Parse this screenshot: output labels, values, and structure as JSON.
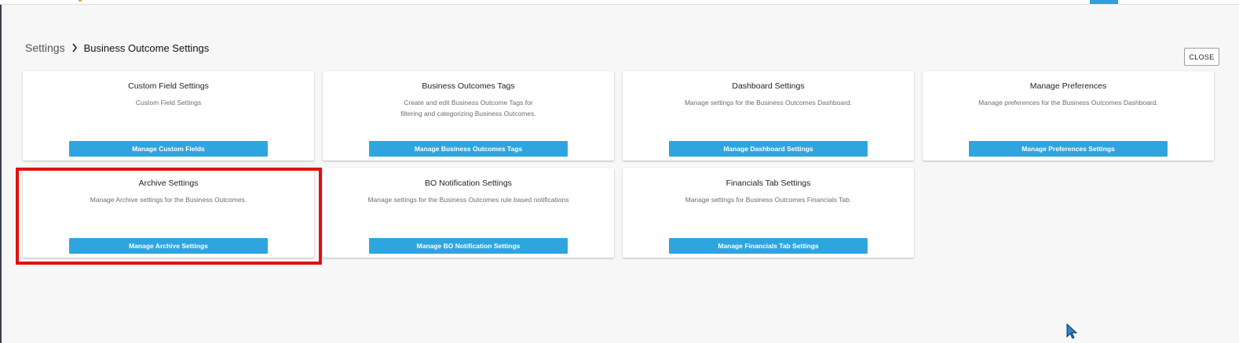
{
  "breadcrumb": {
    "root": "Settings",
    "current": "Business Outcome Settings"
  },
  "close_button": "CLOSE",
  "cards": [
    {
      "title": "Custom Field Settings",
      "description": [
        "Custom Field Settings"
      ],
      "button": "Manage Custom Fields"
    },
    {
      "title": "Business Outcomes Tags",
      "description": [
        "Create and edit Business Outcome Tags for",
        "filtering and categorizing Business Outcomes."
      ],
      "button": "Manage Business Outcomes Tags"
    },
    {
      "title": "Dashboard Settings",
      "description": [
        "Manage settings for the Business Outcomes Dashboard."
      ],
      "button": "Manage Dashboard Settings"
    },
    {
      "title": "Manage Preferences",
      "description": [
        "Manage preferences for the Business Outcomes Dashboard."
      ],
      "button": "Manage Preferences Settings"
    },
    {
      "title": "Archive Settings",
      "description": [
        "Manage Archive settings for the Business Outcomes."
      ],
      "button": "Manage Archive Settings"
    },
    {
      "title": "BO Notification Settings",
      "description": [
        "Manage settings for the Business Outcomes rule based notifications"
      ],
      "button": "Manage BO Notification Settings"
    },
    {
      "title": "Financials Tab Settings",
      "description": [
        "Manage settings for Business Outcomes Financials Tab."
      ],
      "button": "Manage Financials Tab Settings"
    }
  ],
  "colors": {
    "button": "#2fa5e0",
    "highlight": "#e01010",
    "background": "#f7f7f8"
  },
  "icons": {
    "breadcrumb_separator": "chevron-right-icon",
    "cursor": "mouse-pointer-icon"
  }
}
